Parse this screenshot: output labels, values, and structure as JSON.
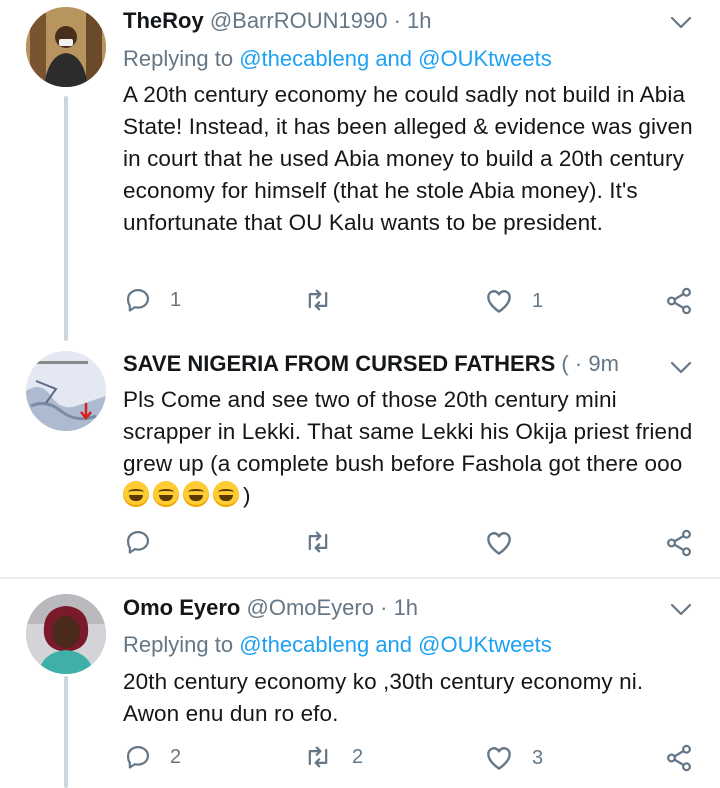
{
  "tweets": [
    {
      "name": "TheRoy",
      "handle": "@BarrROUN1990",
      "time": "1h",
      "replying_prefix": "Replying to",
      "replying_to_1": "@thecableng",
      "replying_and": "and",
      "replying_to_2": "@OUKtweets",
      "body": "A 20th century economy he could sadly not build in Abia State! Instead, it has been alleged & evidence was given in court that he used Abia money to build a 20th century economy for himself (that he stole Abia money). It's unfortunate that OU Kalu wants to be president.",
      "reply_count": "1",
      "retweet_count": "",
      "like_count": "1"
    },
    {
      "name": "SAVE NIGERIA FROM CURSED FATHERS",
      "handle": "(",
      "time": "9m",
      "body": "Pls Come and see two of those 20th century mini scrapper in Lekki. That same Lekki his Okija priest friend grew up (a complete bush before Fashola got there ooo",
      "body_suffix": ")",
      "reply_count": "",
      "retweet_count": "",
      "like_count": ""
    },
    {
      "name": "Omo Eyero",
      "handle": "@OmoEyero",
      "time": "1h",
      "replying_prefix": "Replying to",
      "replying_to_1": "@thecableng",
      "replying_and": "and",
      "replying_to_2": "@OUKtweets",
      "body": "20th century economy ko ,30th century economy ni. Awon enu dun ro efo.",
      "reply_count": "2",
      "retweet_count": "2",
      "like_count": "3"
    }
  ],
  "icons": {
    "reply": "reply-icon",
    "retweet": "retweet-icon",
    "like": "heart-icon",
    "share": "share-icon",
    "menu": "chevron-down-icon"
  },
  "colors": {
    "link": "#1da1f2",
    "secondary": "#657786",
    "divider": "#e6ecf0"
  }
}
